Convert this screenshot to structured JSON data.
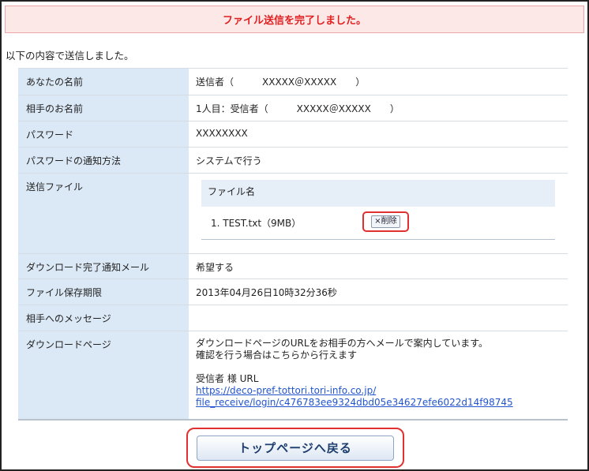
{
  "banner": "ファイル送信を完了しました。",
  "intro": "以下の内容で送信しました。",
  "rows": {
    "sender_label": "あなたの名前",
    "sender_value": "送信者（　　　XXXXX＠XXXXX　　）",
    "recipient_label": "相手のお名前",
    "recipient_value": "1人目：受信者（　　　XXXXX＠XXXXX　　）",
    "password_label": "パスワード",
    "password_value": "XXXXXXXX",
    "notify_label": "パスワードの通知方法",
    "notify_value": "システムで行う",
    "files_label": "送信ファイル",
    "files_header": "ファイル名",
    "file_item": "1. TEST.txt（9MB）",
    "delete_label": "×削除",
    "mail_label": "ダウンロード完了通知メール",
    "mail_value": "希望する",
    "expiry_label": "ファイル保存期限",
    "expiry_value": "2013年04月26日10時32分36秒",
    "message_label": "相手へのメッセージ",
    "message_value": "",
    "download_label": "ダウンロードページ",
    "download_line1": "ダウンロードページのURLをお相手の方へメールで案内しています。",
    "download_line2": "確認を行う場合はこちらから行えます",
    "download_url_label": "受信者 様 URL",
    "download_url_1": "https://deco-pref-tottori.tori-info.co.jp/",
    "download_url_2": "file_receive/login/c476783ee9324dbd05e34627efe6022d14f98745"
  },
  "top_button": "トップページへ戻る"
}
